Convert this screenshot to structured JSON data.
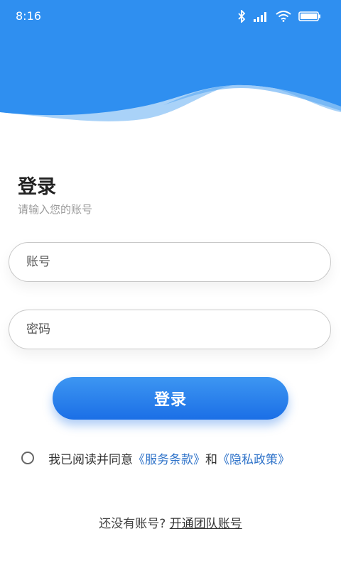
{
  "status_bar": {
    "time": "8:16",
    "icons": [
      "bluetooth-icon",
      "signal-icon",
      "wifi-icon",
      "battery-icon"
    ]
  },
  "colors": {
    "primary": "#2f8ff0",
    "button": "#1b6fe6",
    "link": "#2f73c9"
  },
  "login": {
    "title": "登录",
    "subtitle": "请输入您的账号",
    "account_placeholder": "账号",
    "password_placeholder": "密码",
    "button_label": "登录"
  },
  "agreement": {
    "text": "我已阅读并同意",
    "service_terms": "《服务条款》",
    "and": "和",
    "privacy_policy": "《隐私政策》",
    "checked": false
  },
  "footer": {
    "prompt": "还没有账号?",
    "open_team": "开通团队账号"
  }
}
